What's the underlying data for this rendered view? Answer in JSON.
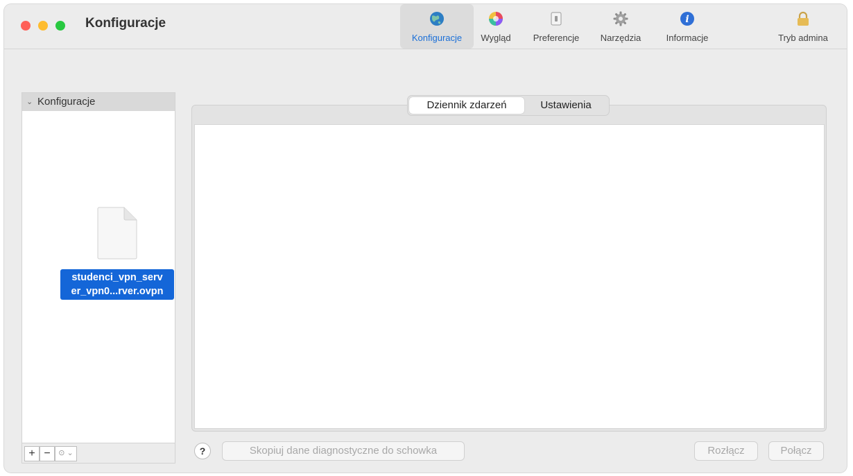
{
  "window": {
    "title": "Konfiguracje"
  },
  "toolbar": {
    "items": [
      {
        "label": "Konfiguracje",
        "icon": "globe-icon",
        "active": true
      },
      {
        "label": "Wygląd",
        "icon": "color-wheel-icon"
      },
      {
        "label": "Preferencje",
        "icon": "switch-icon"
      },
      {
        "label": "Narzędzia",
        "icon": "gear-icon"
      },
      {
        "label": "Informacje",
        "icon": "info-icon"
      }
    ],
    "admin": {
      "label": "Tryb admina",
      "icon": "lock-icon"
    }
  },
  "sidebar": {
    "header": "Konfiguracje",
    "file": {
      "name": "studenci_vpn_serv er_vpn0...rver.ovpn",
      "line1": "studenci_vpn_serv",
      "line2": "er_vpn0...rver.ovpn"
    },
    "bottom": {
      "add": "+",
      "remove": "−",
      "more": "⊙ ⌄"
    }
  },
  "tabs": {
    "log": "Dziennik zdarzeń",
    "settings": "Ustawienia",
    "selected": "log"
  },
  "footer": {
    "help": "?",
    "copy": "Skopiuj dane diagnostyczne do schowka",
    "disconnect": "Rozłącz",
    "connect": "Połącz"
  },
  "colors": {
    "accent": "#1466d8",
    "activeLabel": "#1a6fd8"
  }
}
